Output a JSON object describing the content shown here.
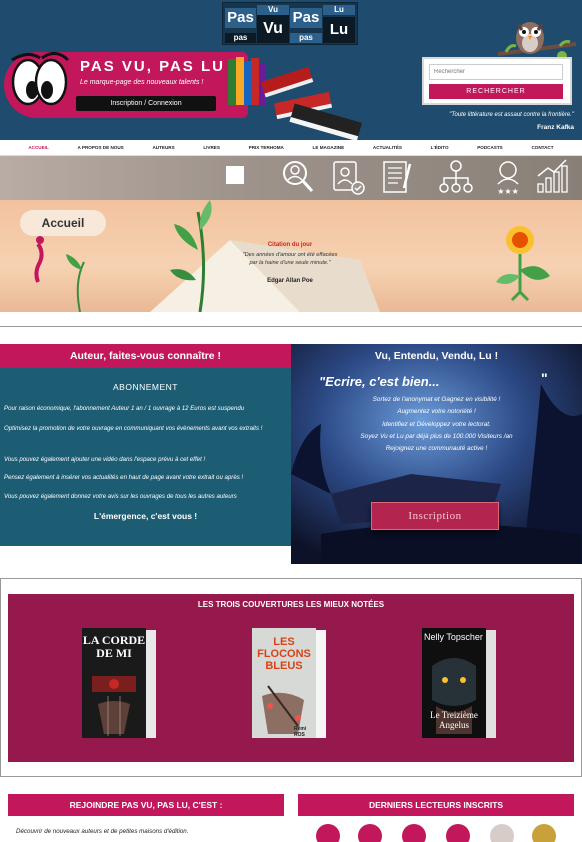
{
  "logo": {
    "pas_left": "Pas",
    "vu_top": "Vu",
    "vu": "Vu",
    "pas_right": "Pas",
    "lu_top": "Lu",
    "lu": "Lu",
    "pas_bottom": "pas",
    "pas_bottom2": "pas"
  },
  "brand": {
    "title": "PAS VU, PAS LU",
    "tagline": "Le marque-page des nouveaux talents !",
    "login_label": "Inscription / Connexion"
  },
  "search": {
    "placeholder": "Rechercher",
    "button_label": "RECHERCHER"
  },
  "header_quote": {
    "text": "\"Toute littérature est assaut contre la frontière.\"",
    "author": "Franz Kafka"
  },
  "nav": {
    "items": [
      {
        "label": "ACCUEIL",
        "active": true
      },
      {
        "label": "A PROPOS DE NOUS"
      },
      {
        "label": "AUTEURS"
      },
      {
        "label": "LIVRES"
      },
      {
        "label": "PRIX TERHOMA"
      },
      {
        "label": "LE MAGAZINE"
      },
      {
        "label": "ACTUALITÉS"
      },
      {
        "label": "L'ÉDITO"
      },
      {
        "label": "PODCASTS"
      },
      {
        "label": "CONTACT"
      }
    ]
  },
  "icons": [
    "search-user-icon",
    "profile-check-icon",
    "document-pen-icon",
    "network-icon",
    "rating-user-icon",
    "growth-chart-icon"
  ],
  "hero": {
    "tag": "Accueil",
    "citation_title": "Citation du jour",
    "citation_text": "\"Des années d'amour ont été effacées par la haine d'une seule minute.\"",
    "citation_author": "Edgar Allan Poe"
  },
  "promo_left": {
    "heading": "Auteur, faites-vous connaître !",
    "subheading": "ABONNEMENT",
    "p1": "Pour raison économique, l'abonnement Auteur 1 an / 1 ouvrage à 12 Euros est suspendu",
    "p2": "Optimisez la promotion de votre ouvrage en communiquant vos évènements avant vos extraits !",
    "p3": "Vous pouvez également ajouter une vidéo dans l'espace prévu à cet effet !",
    "p4": "Pensez également à insérer vos actualités en haut de page avant votre extrait ou après !",
    "p5": "Vous pouvez également donnez votre avis sur les ouvrages de tous les autres auteurs",
    "closing": "L'émergence, c'est vous !"
  },
  "promo_right": {
    "heading": "Vu, Entendu, Vendu, Lu !",
    "ecrire": "\"Ecrire, c'est bien...",
    "end_quote": "\"",
    "line1": "Sortez de l'anonymat et Gagnez en visibilité !",
    "line2": "Augmentez votre notoriété !",
    "line3": "Identifiez et Développez votre lectorat.",
    "line4": "Soyez Vu et Lu par déjà plus de 100.000 Visiteurs /an",
    "line5": "Rejoignez une communauté active !",
    "button_label": "Inscription"
  },
  "top_books": {
    "heading": "LES TROIS COUVERTURES LES MIEUX NOTÉES",
    "books": [
      {
        "title": "LA CORDE DE MI"
      },
      {
        "title": "LES FLOCONS BLEUS",
        "author": "Rémi ROS"
      },
      {
        "title": "Le Treizième Angelus",
        "author": "Nelly Topscher"
      }
    ]
  },
  "join": {
    "heading": "REJOINDRE PAS VU, PAS LU, C'EST :",
    "text": "Découvrir de nouveaux auteurs et de petites maisons d'édition."
  },
  "readers": {
    "heading": "DERNIERS LECTEURS INSCRITS"
  }
}
